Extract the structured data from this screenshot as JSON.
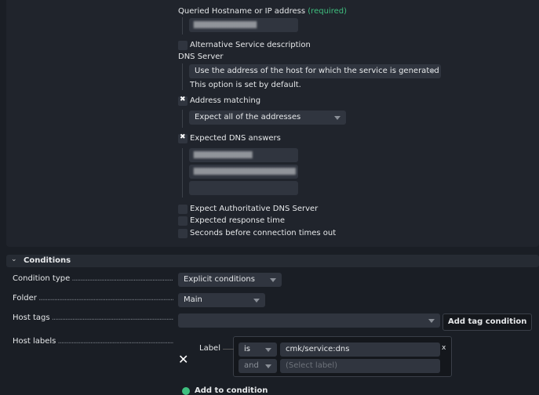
{
  "form": {
    "hostname_label": "Queried Hostname or IP address",
    "required_label": "(required)",
    "alt_service_label": "Alternative Service description",
    "dns_server_label": "DNS Server",
    "dns_server_value": "Use the address of the host for which the service is generated",
    "dns_server_hint": "This option is set by default.",
    "address_matching_label": "Address matching",
    "address_matching_checked": true,
    "address_matching_value": "Expect all of the addresses",
    "expected_answers_label": "Expected DNS answers",
    "expected_answers_checked": true,
    "authoritative_label": "Expect Authoritative DNS Server",
    "response_time_label": "Expected response time",
    "timeout_label": "Seconds before connection times out"
  },
  "conditions": {
    "title": "Conditions",
    "condition_type_label": "Condition type",
    "condition_type_value": "Explicit conditions",
    "folder_label": "Folder",
    "folder_value": "Main",
    "host_tags_label": "Host tags",
    "add_tag_button": "Add tag condition",
    "host_labels_label": "Host labels",
    "label_text": "Label",
    "op1": "is",
    "label1": "cmk/service:dns",
    "op2": "and",
    "label2_placeholder": "(Select label)",
    "remove": "x",
    "add_to_condition": "Add to condition"
  },
  "colors": {
    "accent": "#3fbf7f",
    "background": "#1a1e25"
  }
}
